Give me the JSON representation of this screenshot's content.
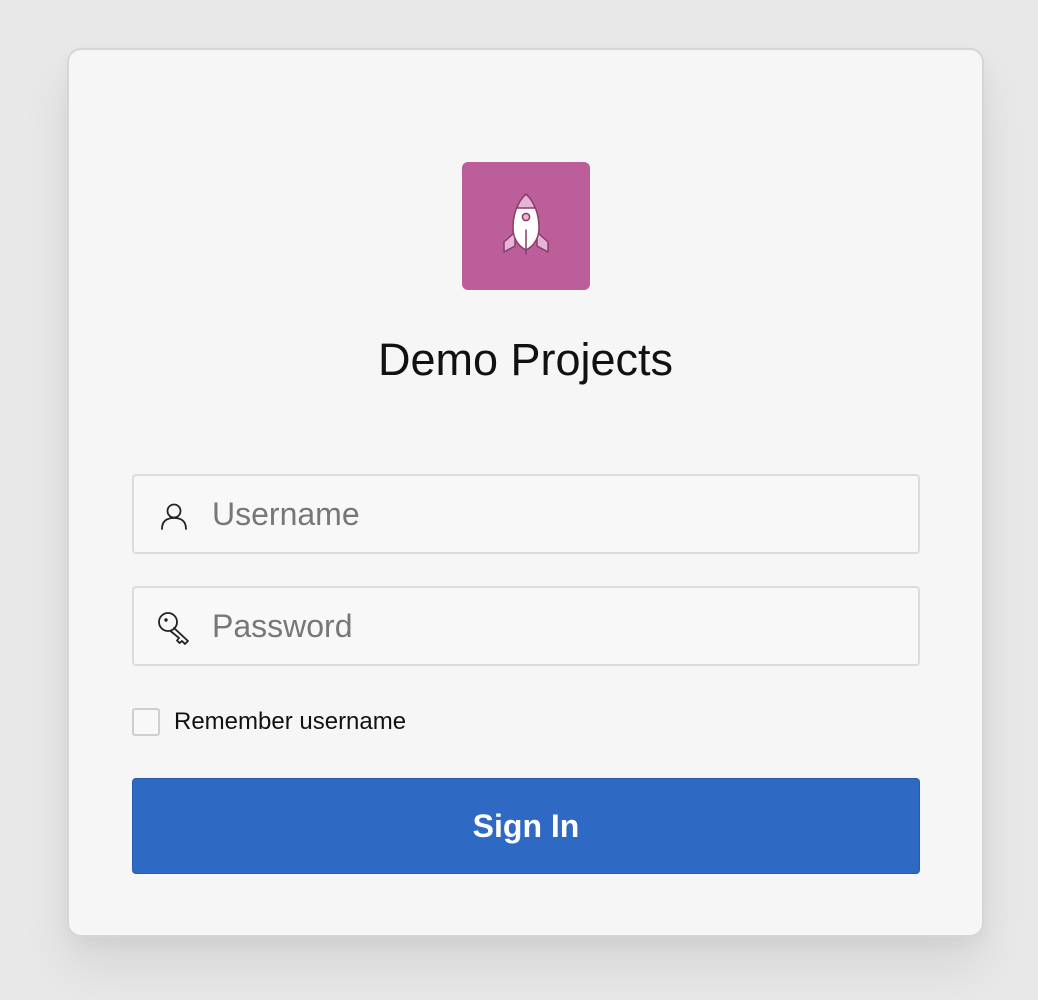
{
  "app": {
    "title": "Demo Projects",
    "logo_icon": "rocket-icon",
    "logo_color": "#bc5e9a"
  },
  "form": {
    "username": {
      "placeholder": "Username",
      "value": "",
      "icon": "user-icon"
    },
    "password": {
      "placeholder": "Password",
      "value": "",
      "icon": "key-icon"
    },
    "remember": {
      "label": "Remember username",
      "checked": false
    },
    "submit_label": "Sign In",
    "accent_color": "#2e69c3"
  }
}
